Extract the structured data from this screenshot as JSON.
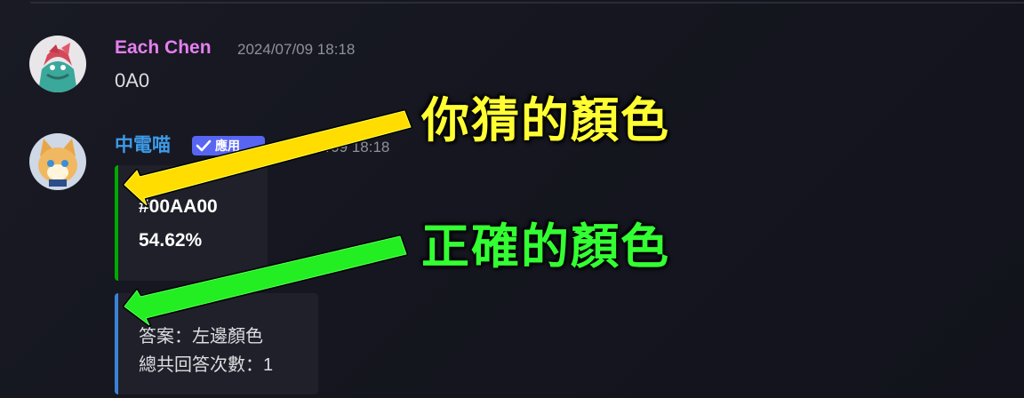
{
  "messages": [
    {
      "author": "Each Chen",
      "author_color": "#e47ff0",
      "timestamp": "2024/07/09 18:18",
      "content": "0A0"
    },
    {
      "author": "中電喵",
      "author_color": "#3d9be9",
      "badge": "應用",
      "timestamp": "2024/07/09 18:18",
      "embeds": [
        {
          "stripe_color": "#00aa00",
          "lines": [
            "#00AA00",
            "54.62%"
          ]
        },
        {
          "stripe_color": "#3b82d6",
          "lines": [
            "答案：左邊顏色",
            "總共回答次數：1"
          ]
        }
      ]
    }
  ],
  "annotations": {
    "guess_label": "你猜的顏色",
    "guess_color": "#ffff33",
    "correct_label": "正確的顏色",
    "correct_color": "#33ff33"
  }
}
